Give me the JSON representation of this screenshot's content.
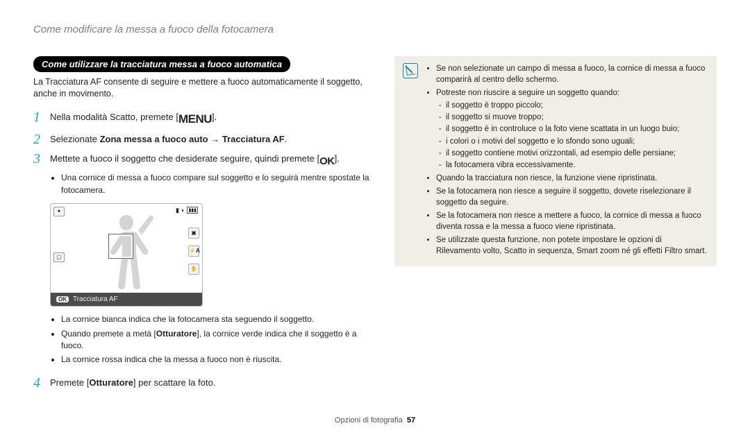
{
  "page_title": "Come modificare la messa a fuoco della fotocamera",
  "section_heading": "Come utilizzare la tracciatura messa a fuoco automatica",
  "intro": "La Tracciatura AF consente di seguire e mettere a fuoco automaticamente il soggetto, anche in movimento.",
  "steps": [
    {
      "num": "1",
      "pre": "Nella modalità Scatto, premete [",
      "icon": "MENU",
      "post": "]."
    },
    {
      "num": "2",
      "pre": "Selezionate ",
      "bold": "Zona messa a fuoco auto → Tracciatura AF",
      "post": "."
    },
    {
      "num": "3",
      "pre": "Mettete a fuoco il soggetto che desiderate seguire, quindi premete [",
      "icon": "OK",
      "post": "].",
      "sub": "Una cornice di messa a fuoco compare sul soggetto e lo seguirà mentre spostate la fotocamera."
    }
  ],
  "camera": {
    "footer_label": "Tracciatura AF",
    "ok_label": "OK"
  },
  "notes": [
    {
      "text": "La cornice bianca indica che la fotocamera sta seguendo il soggetto."
    },
    {
      "pre": "Quando premete a metà [",
      "bold": "Otturatore",
      "post": "], la cornice verde indica che il soggetto è a fuoco."
    },
    {
      "text": "La cornice rossa indica che la messa a fuoco non è riuscita."
    }
  ],
  "step4": {
    "num": "4",
    "pre": "Premete [",
    "bold": "Otturatore",
    "post": "] per scattare la foto."
  },
  "info": {
    "items": [
      {
        "text": "Se non selezionate un campo di messa a fuoco, la cornice di messa a fuoco comparirà al centro dello schermo."
      },
      {
        "text": "Potreste non riuscire a seguire un soggetto quando:",
        "sub": [
          "il soggetto è troppo piccolo;",
          "il soggetto si muove troppo;",
          "il soggetto è in controluce o la foto viene scattata in un luogo buio;",
          "i colori o i motivi del soggetto e lo sfondo sono uguali;",
          "il soggetto contiene motivi orizzontali, ad esempio delle persiane;",
          "la fotocamera vibra eccessivamente."
        ]
      },
      {
        "text": "Quando la tracciatura non riesce, la funzione viene ripristinata."
      },
      {
        "text": "Se la fotocamera non riesce a seguire il soggetto, dovete riselezionare il soggetto da seguire."
      },
      {
        "text": "Se la fotocamera non riesce a mettere a fuoco, la cornice di messa a fuoco diventa rossa e la messa a fuoco viene ripristinata."
      },
      {
        "text": "Se utilizzate questa funzione, non potete impostare le opzioni di Rilevamento volto, Scatto in sequenza, Smart zoom né gli effetti Filtro smart."
      }
    ]
  },
  "footer": {
    "section": "Opzioni di fotografia",
    "page": "57"
  }
}
